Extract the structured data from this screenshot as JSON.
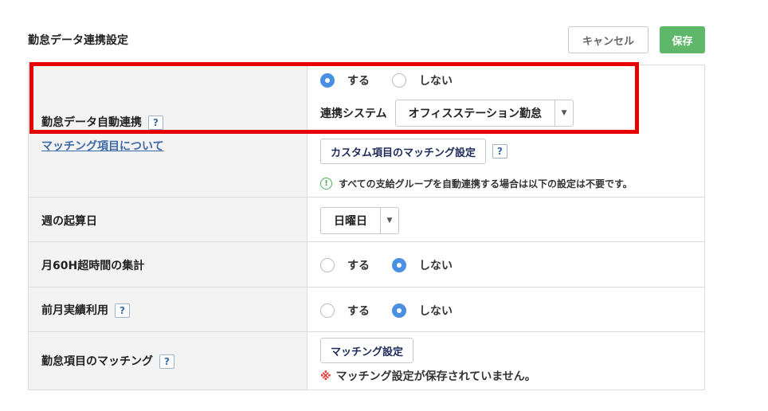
{
  "header": {
    "title": "勤怠データ連携設定",
    "cancel_label": "キャンセル",
    "save_label": "保存"
  },
  "rows": {
    "auto_link": {
      "label": "勤怠データ自動連携",
      "help": "?",
      "link": "マッチング項目について",
      "options": [
        "する",
        "しない"
      ],
      "selected": "する",
      "system_label": "連携システム",
      "system_value": "オフィスステーション勤怠",
      "custom_button": "カスタム項目のマッチング設定",
      "custom_help": "?",
      "note_icon": "!",
      "note": "すべての支給グループを自動連携する場合は以下の設定は不要です。"
    },
    "week_start": {
      "label": "週の起算日",
      "value": "日曜日"
    },
    "overtime60": {
      "label": "月60H超時間の集計",
      "options": [
        "する",
        "しない"
      ],
      "selected": "しない"
    },
    "prev_month": {
      "label": "前月実績利用",
      "help": "?",
      "options": [
        "する",
        "しない"
      ],
      "selected": "しない"
    },
    "matching": {
      "label": "勤怠項目のマッチング",
      "help": "?",
      "button": "マッチング設定",
      "warn_mark": "※",
      "warning": "マッチング設定が保存されていません。"
    }
  },
  "colors": {
    "accent_radio": "#4a90e2",
    "save_button": "#5fb76a",
    "highlight_border": "#e60000",
    "warning_mark": "#e53935",
    "link": "#3e6aa6"
  }
}
